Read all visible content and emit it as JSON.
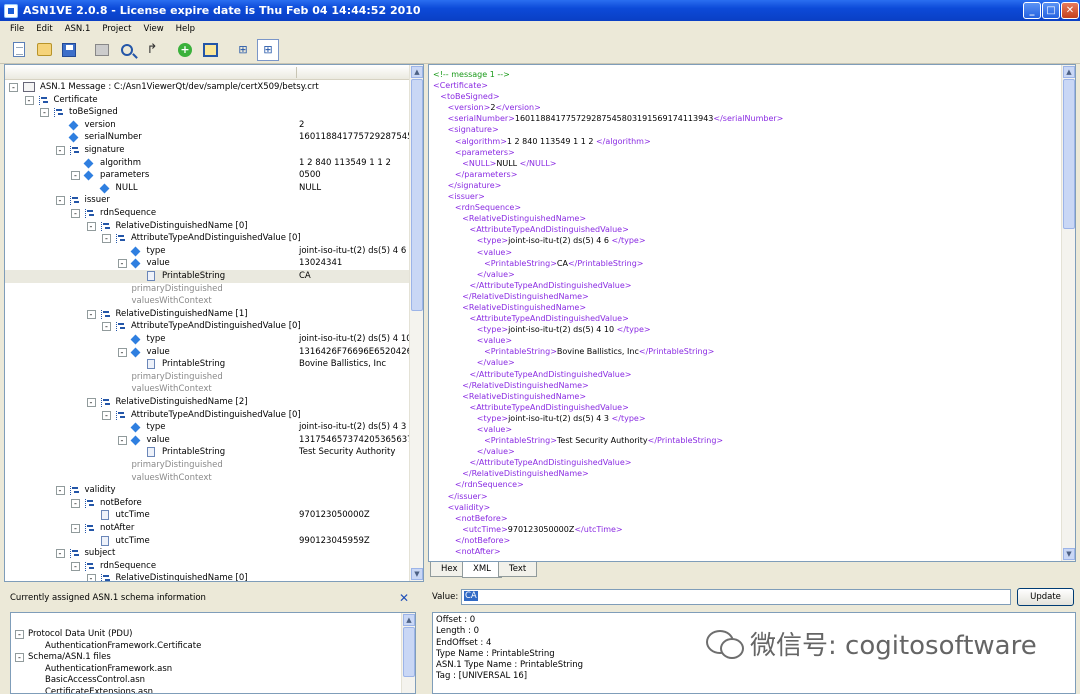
{
  "window": {
    "title": "ASN1VE 2.0.8 - License expire date is Thu Feb 04 14:44:52 2010"
  },
  "menu": [
    "File",
    "Edit",
    "ASN.1",
    "Project",
    "View",
    "Help"
  ],
  "toolbar": [
    {
      "name": "new-document-icon",
      "glyph": "doc"
    },
    {
      "name": "open-icon",
      "glyph": "open"
    },
    {
      "name": "save-icon",
      "glyph": "save"
    },
    {
      "name": "print-icon",
      "glyph": "print"
    },
    {
      "name": "find-icon",
      "glyph": "find"
    },
    {
      "name": "goto-icon",
      "glyph": "goto"
    },
    {
      "name": "add-schema-icon",
      "glyph": "add"
    },
    {
      "name": "frame-icon",
      "glyph": "frame"
    },
    {
      "name": "tree-view-icon",
      "glyph": "tree"
    },
    {
      "name": "tree-expand-icon",
      "glyph": "tree"
    }
  ],
  "tree": [
    {
      "d": 0,
      "exp": "-",
      "icon": "msg",
      "label": "ASN.1 Message : C:/Asn1ViewerQt/dev/sample/certX509/betsy.crt",
      "value": ""
    },
    {
      "d": 1,
      "exp": "-",
      "icon": "seq",
      "label": "Certificate",
      "value": ""
    },
    {
      "d": 2,
      "exp": "-",
      "icon": "seq",
      "label": "toBeSigned",
      "value": ""
    },
    {
      "d": 3,
      "exp": "",
      "icon": "dia",
      "label": "version",
      "value": "2"
    },
    {
      "d": 3,
      "exp": "",
      "icon": "dia",
      "label": "serialNumber",
      "value": "160118841775729287545..."
    },
    {
      "d": 3,
      "exp": "-",
      "icon": "seq",
      "label": "signature",
      "value": ""
    },
    {
      "d": 4,
      "exp": "",
      "icon": "dia",
      "label": "algorithm",
      "value": "1 2 840 113549 1 1 2"
    },
    {
      "d": 4,
      "exp": "-",
      "icon": "dia",
      "label": "parameters",
      "value": "0500"
    },
    {
      "d": 5,
      "exp": "",
      "icon": "dia",
      "label": "NULL",
      "value": "NULL"
    },
    {
      "d": 3,
      "exp": "-",
      "icon": "seq",
      "label": "issuer",
      "value": ""
    },
    {
      "d": 4,
      "exp": "-",
      "icon": "seq",
      "label": "rdnSequence",
      "value": ""
    },
    {
      "d": 5,
      "exp": "-",
      "icon": "seq",
      "label": "RelativeDistinguishedName [0]",
      "value": ""
    },
    {
      "d": 6,
      "exp": "-",
      "icon": "seq",
      "label": "AttributeTypeAndDistinguishedValue [0]",
      "value": ""
    },
    {
      "d": 7,
      "exp": "",
      "icon": "dia",
      "label": "type",
      "value": "joint-iso-itu-t(2) ds(5) 4 6"
    },
    {
      "d": 7,
      "exp": "-",
      "icon": "dia",
      "label": "value",
      "value": "13024341"
    },
    {
      "d": 8,
      "exp": "",
      "icon": "doc",
      "label": "PrintableString",
      "value": "CA",
      "sel": true
    },
    {
      "d": 7,
      "exp": "",
      "icon": "",
      "label": "primaryDistinguished",
      "value": "",
      "gray": true
    },
    {
      "d": 7,
      "exp": "",
      "icon": "",
      "label": "valuesWithContext",
      "value": "",
      "gray": true
    },
    {
      "d": 5,
      "exp": "-",
      "icon": "seq",
      "label": "RelativeDistinguishedName [1]",
      "value": ""
    },
    {
      "d": 6,
      "exp": "-",
      "icon": "seq",
      "label": "AttributeTypeAndDistinguishedValue [0]",
      "value": ""
    },
    {
      "d": 7,
      "exp": "",
      "icon": "dia",
      "label": "type",
      "value": "joint-iso-itu-t(2) ds(5) 4 10"
    },
    {
      "d": 7,
      "exp": "-",
      "icon": "dia",
      "label": "value",
      "value": "1316426F76696E6520426..."
    },
    {
      "d": 8,
      "exp": "",
      "icon": "doc",
      "label": "PrintableString",
      "value": "Bovine Ballistics, Inc"
    },
    {
      "d": 7,
      "exp": "",
      "icon": "",
      "label": "primaryDistinguished",
      "value": "",
      "gray": true
    },
    {
      "d": 7,
      "exp": "",
      "icon": "",
      "label": "valuesWithContext",
      "value": "",
      "gray": true
    },
    {
      "d": 5,
      "exp": "-",
      "icon": "seq",
      "label": "RelativeDistinguishedName [2]",
      "value": ""
    },
    {
      "d": 6,
      "exp": "-",
      "icon": "seq",
      "label": "AttributeTypeAndDistinguishedValue [0]",
      "value": ""
    },
    {
      "d": 7,
      "exp": "",
      "icon": "dia",
      "label": "type",
      "value": "joint-iso-itu-t(2) ds(5) 4 3"
    },
    {
      "d": 7,
      "exp": "-",
      "icon": "dia",
      "label": "value",
      "value": "131754657374205365637..."
    },
    {
      "d": 8,
      "exp": "",
      "icon": "doc",
      "label": "PrintableString",
      "value": "Test Security Authority"
    },
    {
      "d": 7,
      "exp": "",
      "icon": "",
      "label": "primaryDistinguished",
      "value": "",
      "gray": true
    },
    {
      "d": 7,
      "exp": "",
      "icon": "",
      "label": "valuesWithContext",
      "value": "",
      "gray": true
    },
    {
      "d": 3,
      "exp": "-",
      "icon": "seq",
      "label": "validity",
      "value": ""
    },
    {
      "d": 4,
      "exp": "-",
      "icon": "seq",
      "label": "notBefore",
      "value": ""
    },
    {
      "d": 5,
      "exp": "",
      "icon": "doc",
      "label": "utcTime",
      "value": "970123050000Z"
    },
    {
      "d": 4,
      "exp": "-",
      "icon": "seq",
      "label": "notAfter",
      "value": ""
    },
    {
      "d": 5,
      "exp": "",
      "icon": "doc",
      "label": "utcTime",
      "value": "990123045959Z"
    },
    {
      "d": 3,
      "exp": "-",
      "icon": "seq",
      "label": "subject",
      "value": ""
    },
    {
      "d": 4,
      "exp": "-",
      "icon": "seq",
      "label": "rdnSequence",
      "value": ""
    },
    {
      "d": 5,
      "exp": "-",
      "icon": "seq",
      "label": "RelativeDistinguishedName [0]",
      "value": ""
    }
  ],
  "xml_lines": [
    {
      "i": 0,
      "c": true,
      "t": "<!-- message 1 -->"
    },
    {
      "i": 0,
      "o": "<Certificate>"
    },
    {
      "i": 1,
      "o": "<toBeSigned>"
    },
    {
      "i": 2,
      "o": "<version>",
      "x": "2",
      "e": "</version>"
    },
    {
      "i": 2,
      "o": "<serialNumber>",
      "x": "160118841775729287545803191569174113943",
      "e": "</serialNumber>"
    },
    {
      "i": 2,
      "o": "<signature>"
    },
    {
      "i": 3,
      "o": "<algorithm>",
      "x": "1 2 840 113549 1 1 2 ",
      "e": "</algorithm>"
    },
    {
      "i": 3,
      "o": "<parameters>"
    },
    {
      "i": 4,
      "o": "<NULL>",
      "x": "NULL ",
      "e": "</NULL>"
    },
    {
      "i": 3,
      "o": "</parameters>"
    },
    {
      "i": 2,
      "o": "</signature>"
    },
    {
      "i": 2,
      "o": "<issuer>"
    },
    {
      "i": 3,
      "o": "<rdnSequence>"
    },
    {
      "i": 4,
      "o": "<RelativeDistinguishedName>"
    },
    {
      "i": 5,
      "o": "<AttributeTypeAndDistinguishedValue>"
    },
    {
      "i": 6,
      "o": "<type>",
      "x": "joint-iso-itu-t(2) ds(5) 4 6 ",
      "e": "</type>"
    },
    {
      "i": 6,
      "o": "<value>"
    },
    {
      "i": 7,
      "o": "<PrintableString>",
      "x": "CA",
      "e": "</PrintableString>"
    },
    {
      "i": 6,
      "o": "</value>"
    },
    {
      "i": 5,
      "o": "</AttributeTypeAndDistinguishedValue>"
    },
    {
      "i": 4,
      "o": "</RelativeDistinguishedName>"
    },
    {
      "i": 4,
      "o": "<RelativeDistinguishedName>"
    },
    {
      "i": 5,
      "o": "<AttributeTypeAndDistinguishedValue>"
    },
    {
      "i": 6,
      "o": "<type>",
      "x": "joint-iso-itu-t(2) ds(5) 4 10 ",
      "e": "</type>"
    },
    {
      "i": 6,
      "o": "<value>"
    },
    {
      "i": 7,
      "o": "<PrintableString>",
      "x": "Bovine Ballistics, Inc",
      "e": "</PrintableString>"
    },
    {
      "i": 6,
      "o": "</value>"
    },
    {
      "i": 5,
      "o": "</AttributeTypeAndDistinguishedValue>"
    },
    {
      "i": 4,
      "o": "</RelativeDistinguishedName>"
    },
    {
      "i": 4,
      "o": "<RelativeDistinguishedName>"
    },
    {
      "i": 5,
      "o": "<AttributeTypeAndDistinguishedValue>"
    },
    {
      "i": 6,
      "o": "<type>",
      "x": "joint-iso-itu-t(2) ds(5) 4 3 ",
      "e": "</type>"
    },
    {
      "i": 6,
      "o": "<value>"
    },
    {
      "i": 7,
      "o": "<PrintableString>",
      "x": "Test Security Authority",
      "e": "</PrintableString>"
    },
    {
      "i": 6,
      "o": "</value>"
    },
    {
      "i": 5,
      "o": "</AttributeTypeAndDistinguishedValue>"
    },
    {
      "i": 4,
      "o": "</RelativeDistinguishedName>"
    },
    {
      "i": 3,
      "o": "</rdnSequence>"
    },
    {
      "i": 2,
      "o": "</issuer>"
    },
    {
      "i": 2,
      "o": "<validity>"
    },
    {
      "i": 3,
      "o": "<notBefore>"
    },
    {
      "i": 4,
      "o": "<utcTime>",
      "x": "970123050000Z",
      "e": "</utcTime>"
    },
    {
      "i": 3,
      "o": "</notBefore>"
    },
    {
      "i": 3,
      "o": "<notAfter>"
    }
  ],
  "tabs": {
    "hex": "Hex",
    "xml": "XML",
    "text": "Text",
    "active": "XML"
  },
  "schema": {
    "header": "Currently assigned ASN.1 schema information",
    "close": "✕",
    "rows": [
      {
        "d": 0,
        "exp": "-",
        "label": "Protocol Data Unit (PDU)"
      },
      {
        "d": 1,
        "exp": "",
        "label": "AuthenticationFramework.Certificate"
      },
      {
        "d": 0,
        "exp": "-",
        "label": "Schema/ASN.1 files"
      },
      {
        "d": 1,
        "exp": "",
        "label": "AuthenticationFramework.asn"
      },
      {
        "d": 1,
        "exp": "",
        "label": "BasicAccessControl.asn"
      },
      {
        "d": 1,
        "exp": "",
        "label": "CertificateExtensions.asn"
      }
    ]
  },
  "value_bar": {
    "label": "Value:",
    "value": "CA",
    "update_label": "Update"
  },
  "info": [
    "Offset : 0",
    "Length : 0",
    "EndOffset : 4",
    "Type Name : PrintableString",
    "ASN.1 Type Name : PrintableString",
    "Tag : [UNIVERSAL 16]"
  ],
  "watermark": {
    "text": "微信号: cogitosoftware"
  },
  "colors": {
    "titlebar": "#0c4ad8",
    "xml_tag": "#8a2be2",
    "xml_comment": "#1a9a1a",
    "selection": "#316ac5"
  }
}
